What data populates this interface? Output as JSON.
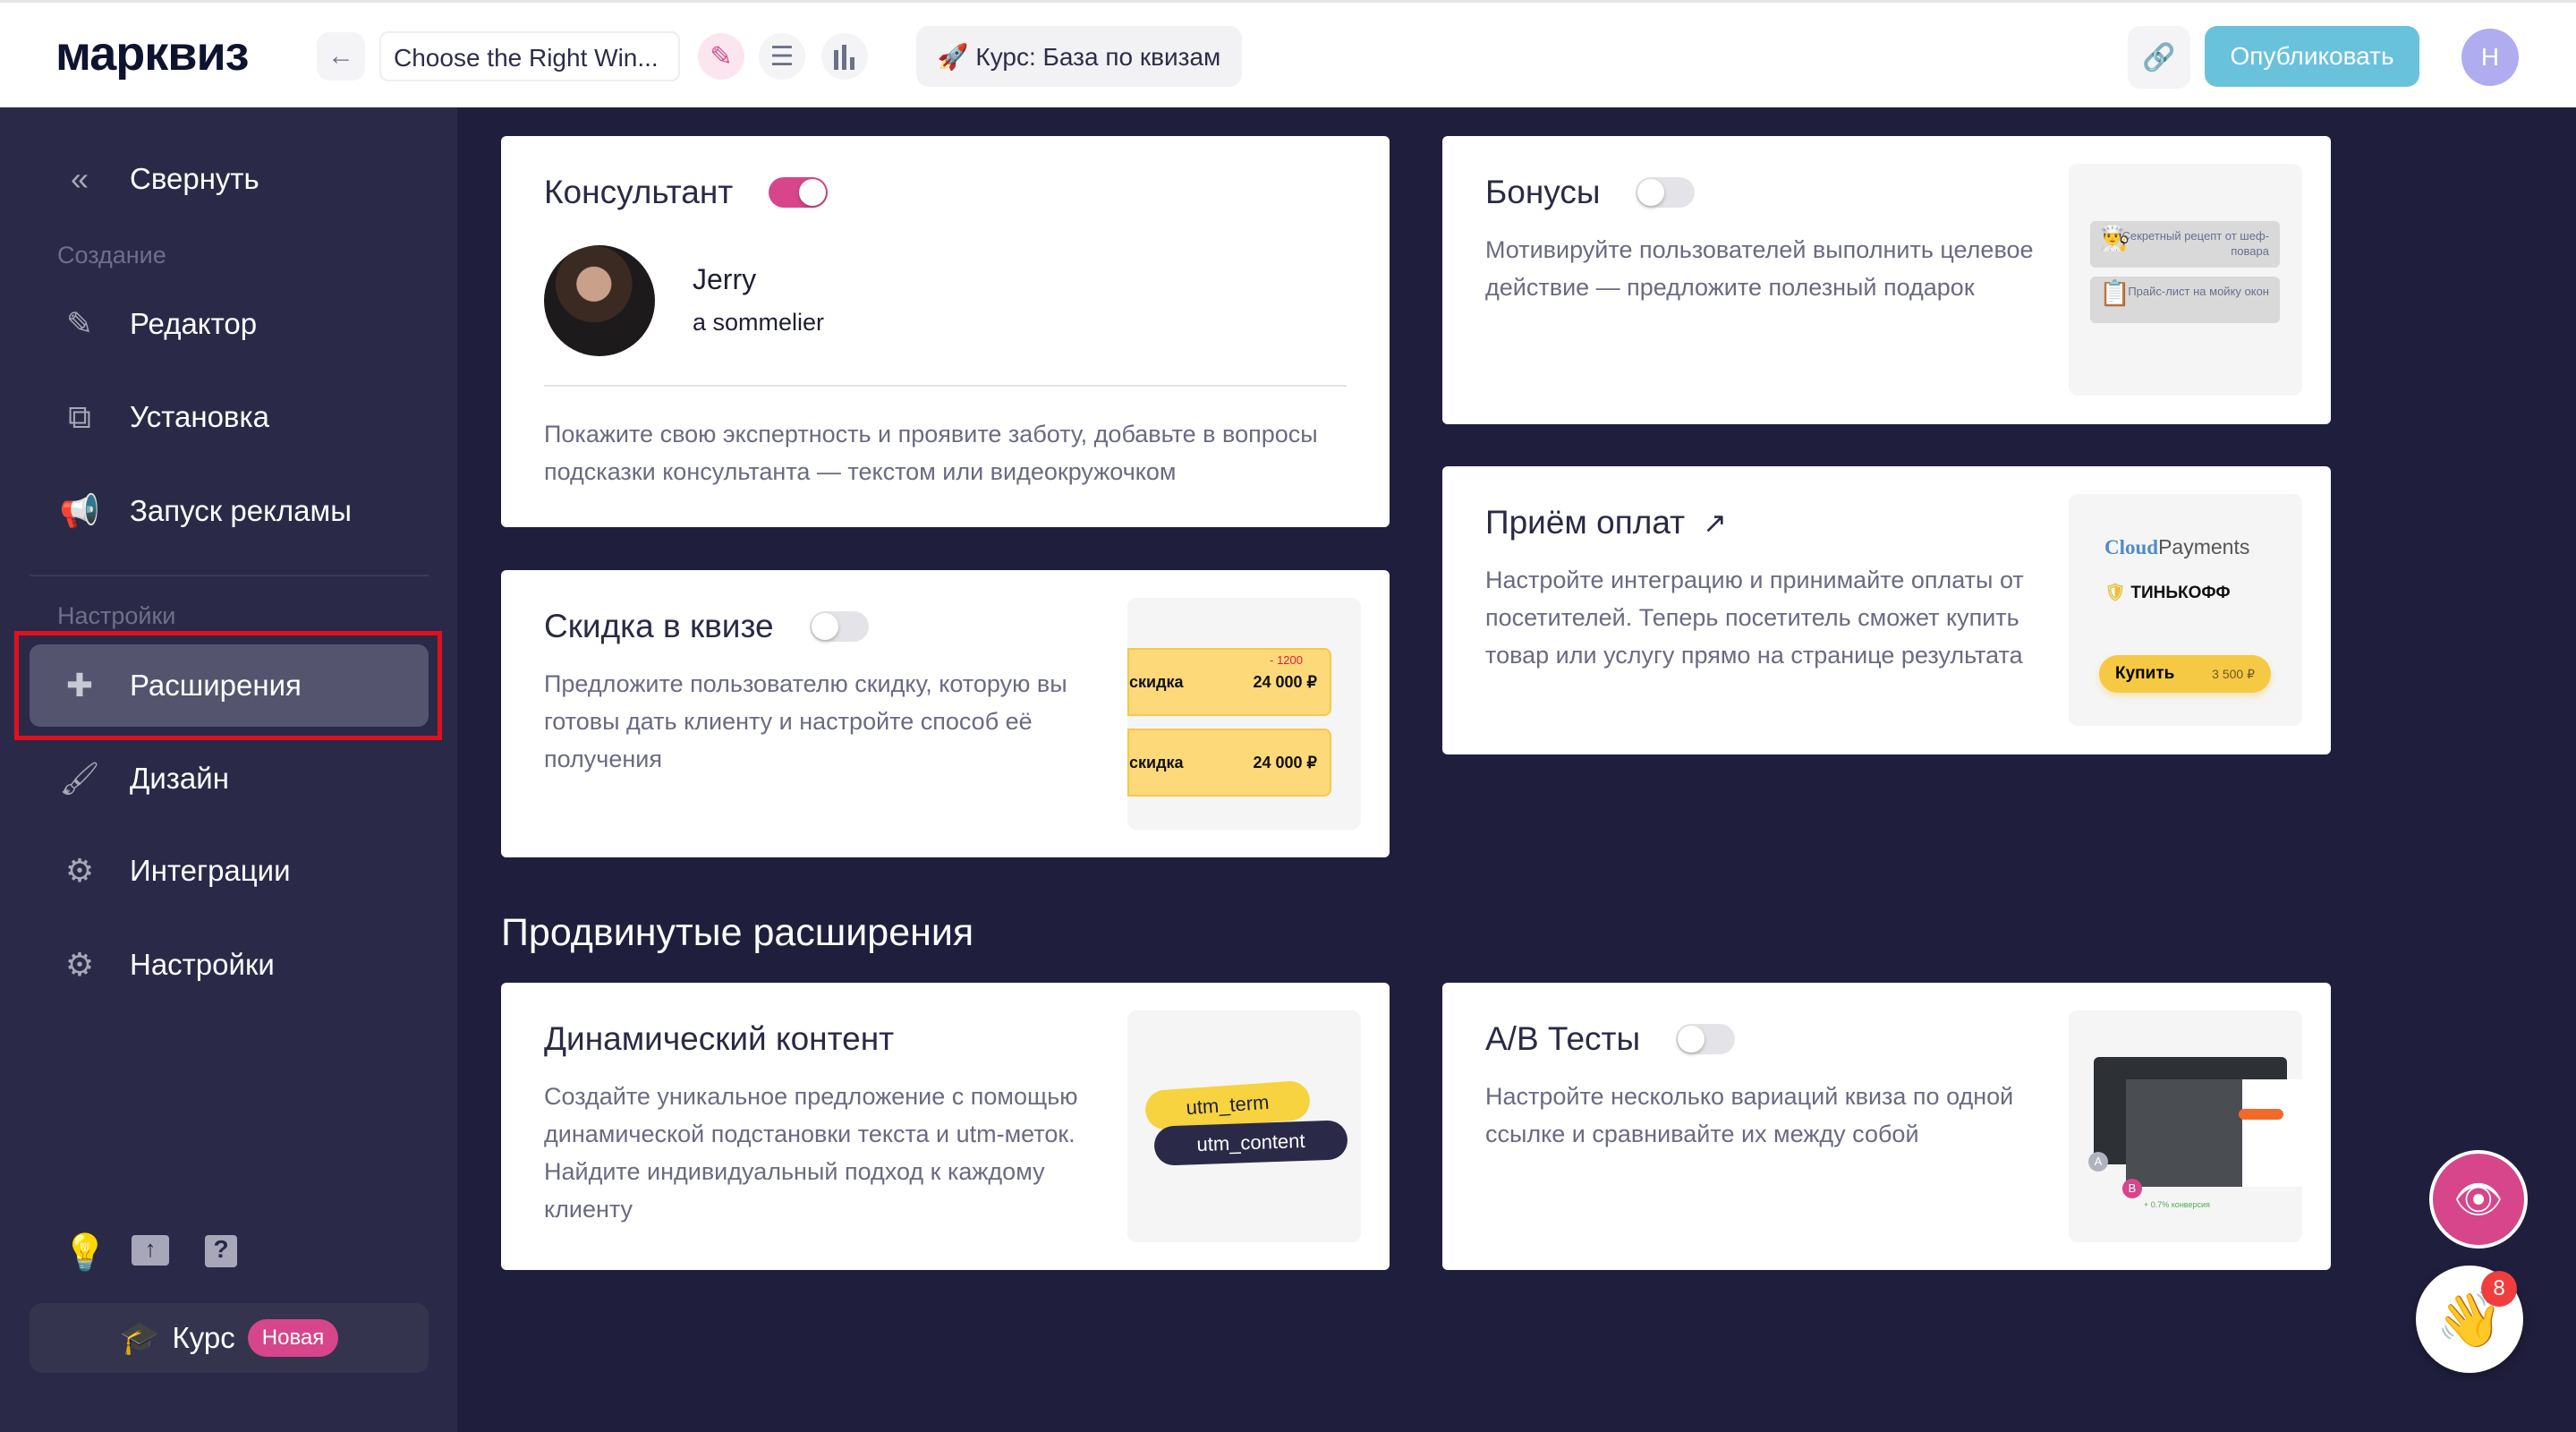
{
  "header": {
    "logo": "марквиз",
    "quiz_title": "Choose the Right Win...",
    "course_chip": "🚀 Курс: База по квизам",
    "publish": "Опубликовать",
    "avatar_initial": "Н"
  },
  "sidebar": {
    "collapse": "Свернуть",
    "section_create": "Создание",
    "items_create": [
      "Редактор",
      "Установка",
      "Запуск рекламы"
    ],
    "section_settings": "Настройки",
    "items_settings": [
      "Расширения",
      "Дизайн",
      "Интеграции",
      "Настройки"
    ],
    "course": "Курс",
    "course_badge": "Новая"
  },
  "cards": {
    "consultant": {
      "title": "Консультант",
      "enabled": true,
      "name": "Jerry",
      "role": "a sommelier",
      "desc": "Покажите свою экспертность и проявите заботу, добавьте в вопросы подсказки консультанта — текстом или видеокружочком"
    },
    "bonuses": {
      "title": "Бонусы",
      "enabled": false,
      "desc": "Мотивируйте пользователей выполнить целевое действие — предложите полезный подарок",
      "preview": [
        "Секретный рецепт от шеф-повара",
        "Прайс-лист на мойку окон"
      ]
    },
    "discount": {
      "title": "Скидка в квизе",
      "enabled": false,
      "desc": "Предложите пользователю скидку, которую вы готовы дать клиенту и настройте способ её получения",
      "preview": {
        "label": "скидка",
        "price": "24 000 ₽",
        "delta": "- 1200"
      }
    },
    "payments": {
      "title": "Приём оплат",
      "desc": "Настройте интеграцию и принимайте оплаты от посетителей. Теперь посетитель сможет купить товар или услугу прямо на странице результата",
      "preview": {
        "cloud": "Cloud",
        "payments": "Payments",
        "bank": "ТИНЬКОФФ",
        "buy": "Купить",
        "price": "3 500 ₽"
      }
    }
  },
  "advanced": {
    "heading": "Продвинутые расширения",
    "dynamic": {
      "title": "Динамический контент",
      "desc": "Создайте уникальное предложение с помощью динамической подстановки текста и utm-меток. Найдите индивидуальный подход к каждому клиенту",
      "tags": [
        "utm_term",
        "utm_content"
      ]
    },
    "ab": {
      "title": "A/B Тесты",
      "enabled": false,
      "desc": "Настройте несколько вариаций квиза по одной ссылке и сравнивайте их между собой",
      "preview": {
        "a": "A",
        "b": "B",
        "conversion": "+ 0.7% конверсия"
      }
    }
  },
  "floating": {
    "notifications": "8"
  },
  "colors": {
    "accent": "#d7468a",
    "publish": "#69c2dc",
    "sidebar": "#2a2a48",
    "main": "#1f1f3d"
  }
}
